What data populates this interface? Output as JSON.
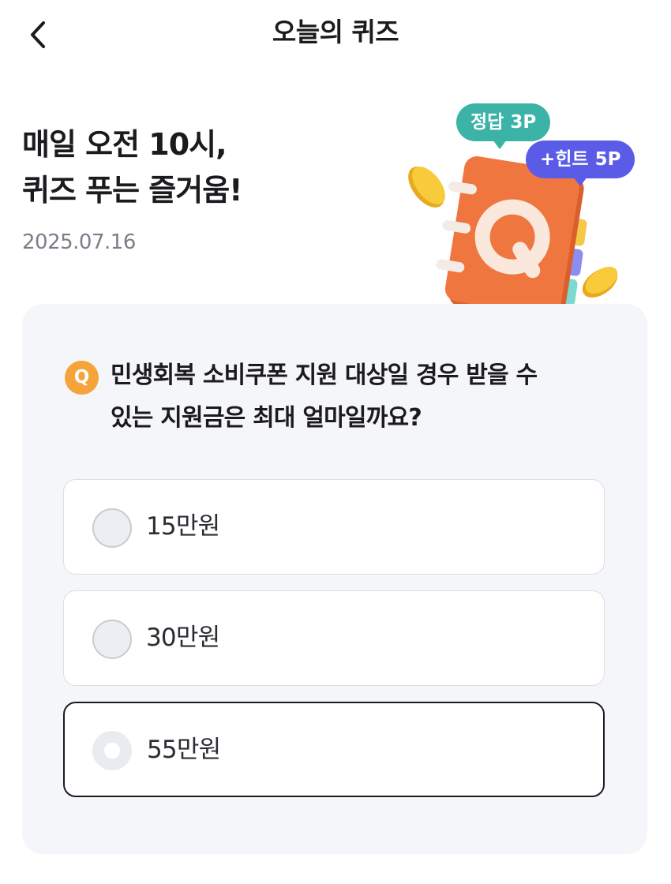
{
  "header": {
    "title": "오늘의 퀴즈",
    "back_icon": "chevron-left-icon"
  },
  "intro": {
    "headline_line1": "매일 오전 10시,",
    "headline_line2": "퀴즈 푸는 즐거움!",
    "date": "2025.07.16"
  },
  "illustration": {
    "badge_answer": "정답 3P",
    "badge_hint": "+힌트 5P",
    "book_letter": "Q",
    "colors": {
      "answer_bubble": "#3bb3a7",
      "hint_bubble": "#5a5ce8",
      "notebook": "#f0763f",
      "coin": "#f2c12e"
    }
  },
  "quiz": {
    "badge": "Q",
    "question_line1": "민생회복 소비쿠폰 지원 대상일 경우 받을 수",
    "question_line2": "있는 지원금은 최대 얼마일까요?",
    "options": [
      {
        "label": "15만원",
        "selected": false
      },
      {
        "label": "30만원",
        "selected": false
      },
      {
        "label": "55만원",
        "selected": true
      }
    ]
  }
}
